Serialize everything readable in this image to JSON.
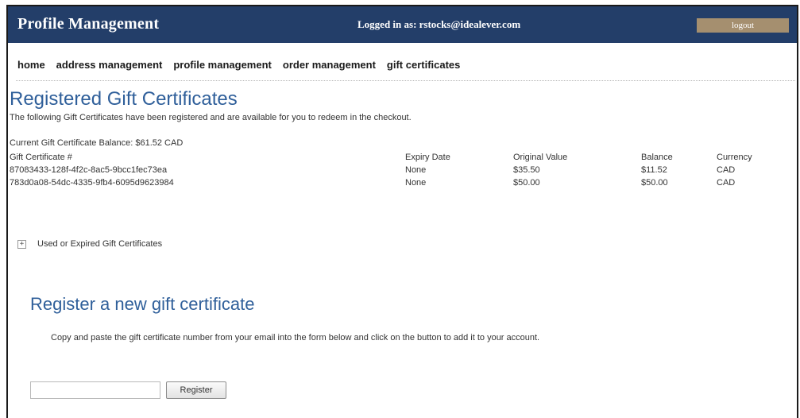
{
  "header": {
    "title": "Profile Management",
    "login_status": "Logged in as: rstocks@idealever.com",
    "logout_label": "logout"
  },
  "nav": {
    "items": [
      {
        "label": "home"
      },
      {
        "label": "address management"
      },
      {
        "label": "profile management"
      },
      {
        "label": "order management"
      },
      {
        "label": "gift certificates"
      }
    ]
  },
  "main": {
    "title": "Registered Gift Certificates",
    "intro": "The following Gift Certificates have been registered and are available for you to redeem in the checkout.",
    "balance": "Current Gift Certificate Balance: $61.52 CAD",
    "table": {
      "headers": [
        "Gift Certificate #",
        "Expiry Date",
        "Original Value",
        "Balance",
        "Currency"
      ],
      "rows": [
        [
          "87083433-128f-4f2c-8ac5-9bcc1fec73ea",
          "None",
          "$35.50",
          "$11.52",
          "CAD"
        ],
        [
          "783d0a08-54dc-4335-9fb4-6095d9623984",
          "None",
          "$50.00",
          "$50.00",
          "CAD"
        ]
      ]
    },
    "expander_icon": "plus-box-icon",
    "expander_label": "Used or Expired Gift Certificates"
  },
  "register": {
    "title": "Register a new gift certificate",
    "description": "Copy and paste the gift certificate number from your email into the form below and click on the button to add it to your account.",
    "input_value": "",
    "input_placeholder": "",
    "button_label": "Register"
  },
  "colors": {
    "header_bg": "#233e69",
    "logout_bg": "#a58f6f",
    "title_blue": "#2f5f9a"
  }
}
